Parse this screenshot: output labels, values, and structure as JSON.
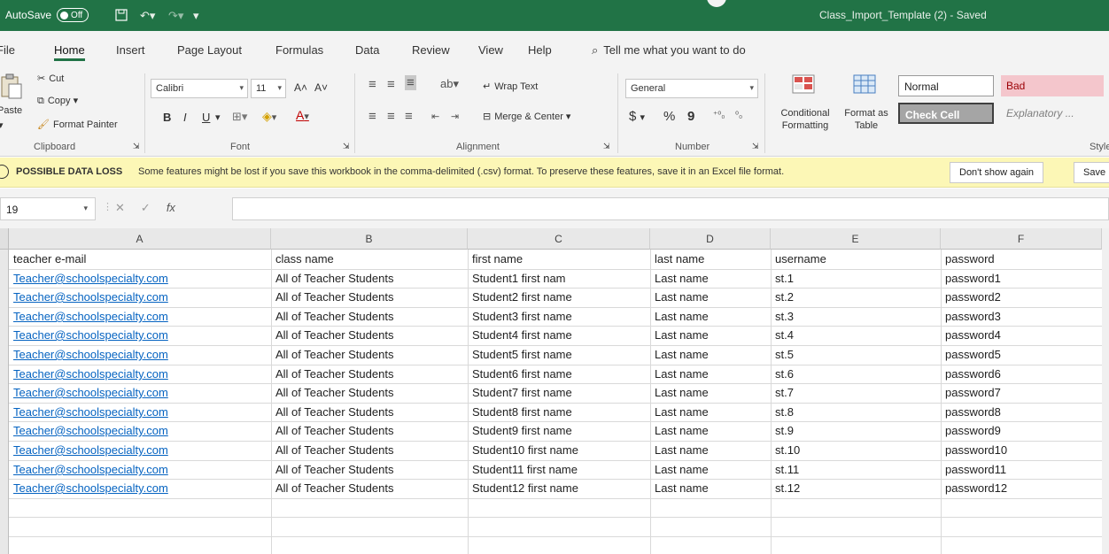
{
  "titlebar": {
    "autosave_label": "AutoSave",
    "autosave_state": "Off",
    "document_title": "Class_Import_Template (2)  -  Saved",
    "accent_color": "#217346"
  },
  "menu": {
    "tabs": [
      "File",
      "Home",
      "Insert",
      "Page Layout",
      "Formulas",
      "Data",
      "Review",
      "View",
      "Help"
    ],
    "active_tab": "Home",
    "tell_me": "Tell me what you want to do"
  },
  "ribbon": {
    "clipboard": {
      "paste": "Paste",
      "cut": "Cut",
      "copy": "Copy",
      "format_painter": "Format Painter",
      "group_label": "Clipboard"
    },
    "font": {
      "font_name": "Calibri",
      "font_size": "11",
      "grow": "A˄",
      "shrink": "A˅",
      "bold": "B",
      "italic": "I",
      "underline": "U",
      "group_label": "Font"
    },
    "alignment": {
      "wrap_text": "Wrap Text",
      "merge_center": "Merge & Center",
      "group_label": "Alignment"
    },
    "number": {
      "format": "General",
      "currency": "$",
      "percent": "%",
      "comma": "9",
      "group_label": "Number"
    },
    "styles": {
      "conditional_formatting": "Conditional Formatting",
      "format_as_table": "Format as Table",
      "normal": "Normal",
      "bad": "Bad",
      "check_cell": "Check Cell",
      "explanatory": "Explanatory ...",
      "group_label": "Style"
    }
  },
  "infobar": {
    "title": "POSSIBLE DATA LOSS",
    "message": "Some features might be lost if you save this workbook in the comma-delimited (.csv) format. To preserve these features, save it in an Excel file format.",
    "dont_show_again": "Don't show again",
    "save_as": "Save"
  },
  "formula_bar": {
    "name_box": "19",
    "cancel": "✕",
    "enter": "✓",
    "fx": "fx",
    "value": ""
  },
  "sheet": {
    "columns": [
      "A",
      "B",
      "C",
      "D",
      "E",
      "F"
    ],
    "rows": [
      [
        "teacher e-mail",
        "class name",
        "first name",
        "last name",
        "username",
        "password"
      ],
      [
        "Teacher@schoolspecialty.com",
        "All of Teacher Students",
        "Student1 first nam",
        "Last name",
        "st.1",
        "password1"
      ],
      [
        "Teacher@schoolspecialty.com",
        "All of Teacher Students",
        "Student2 first name",
        "Last name",
        "st.2",
        "password2"
      ],
      [
        "Teacher@schoolspecialty.com",
        "All of Teacher Students",
        "Student3 first name",
        "Last name",
        "st.3",
        "password3"
      ],
      [
        "Teacher@schoolspecialty.com",
        "All of Teacher Students",
        "Student4 first name",
        "Last name",
        "st.4",
        "password4"
      ],
      [
        "Teacher@schoolspecialty.com",
        "All of Teacher Students",
        "Student5 first name",
        "Last name",
        "st.5",
        "password5"
      ],
      [
        "Teacher@schoolspecialty.com",
        "All of Teacher Students",
        "Student6 first name",
        "Last name",
        "st.6",
        "password6"
      ],
      [
        "Teacher@schoolspecialty.com",
        "All of Teacher Students",
        "Student7 first name",
        "Last name",
        "st.7",
        "password7"
      ],
      [
        "Teacher@schoolspecialty.com",
        "All of Teacher Students",
        "Student8 first name",
        "Last name",
        "st.8",
        "password8"
      ],
      [
        "Teacher@schoolspecialty.com",
        "All of Teacher Students",
        "Student9 first name",
        "Last name",
        "st.9",
        "password9"
      ],
      [
        "Teacher@schoolspecialty.com",
        "All of Teacher Students",
        "Student10 first name",
        "Last name",
        "st.10",
        "password10"
      ],
      [
        "Teacher@schoolspecialty.com",
        "All of Teacher Students",
        "Student11 first name",
        "Last name",
        "st.11",
        "password11"
      ],
      [
        "Teacher@schoolspecialty.com",
        "All of Teacher Students",
        "Student12 first name",
        "Last name",
        "st.12",
        "password12"
      ]
    ]
  }
}
